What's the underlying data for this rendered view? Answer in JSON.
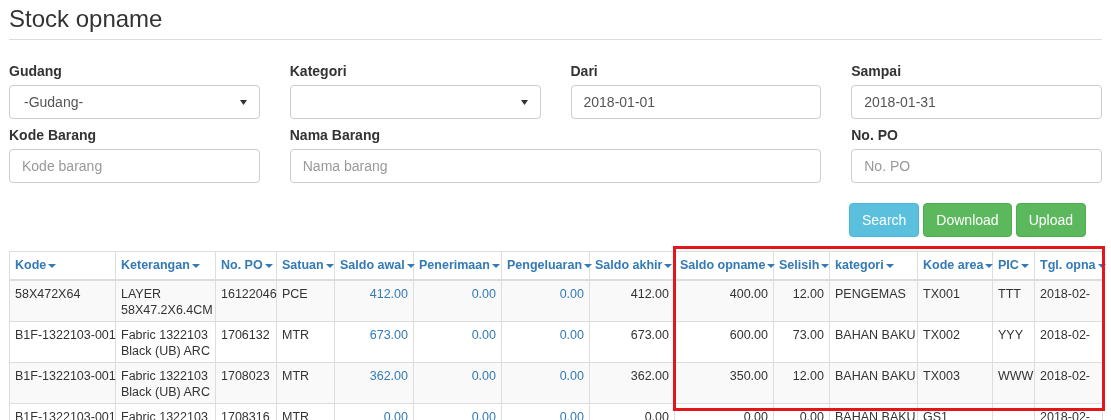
{
  "page": {
    "title": "Stock opname"
  },
  "filters": [
    {
      "label": "Gudang",
      "kind": "select",
      "value": "-Gudang-"
    },
    {
      "label": "Kategori",
      "kind": "select"
    },
    {
      "label": "Dari",
      "kind": "input",
      "value": "2018-01-01"
    },
    {
      "label": "Sampai",
      "kind": "input",
      "value": "2018-01-31"
    },
    {
      "label": "Kode Barang",
      "kind": "input",
      "placeholder": "Kode barang"
    },
    {
      "label": "Nama Barang",
      "kind": "input",
      "placeholder": "Nama barang"
    },
    {
      "label": "No. PO",
      "kind": "input",
      "placeholder": "No. PO"
    }
  ],
  "buttons": [
    {
      "label": "Search",
      "kind": "info"
    },
    {
      "label": "Download",
      "kind": "success"
    },
    {
      "label": "Upload",
      "kind": "success"
    }
  ],
  "table": {
    "columns": [
      {
        "label": "Kode",
        "kind": "text"
      },
      {
        "label": "Keterangan",
        "kind": "text"
      },
      {
        "label": "No. PO",
        "kind": "text"
      },
      {
        "label": "Satuan",
        "kind": "text"
      },
      {
        "label": "Saldo awal",
        "kind": "link"
      },
      {
        "label": "Penerimaan",
        "kind": "link"
      },
      {
        "label": "Pengeluaran",
        "kind": "link"
      },
      {
        "label": "Saldo akhir",
        "kind": "number"
      },
      {
        "label": "Saldo opname",
        "kind": "number"
      },
      {
        "label": "Selisih",
        "kind": "number"
      },
      {
        "label": "kategori",
        "kind": "text"
      },
      {
        "label": "Kode area",
        "kind": "text"
      },
      {
        "label": "PIC",
        "kind": "text"
      },
      {
        "label": "Tgl. opna",
        "kind": "text"
      }
    ],
    "rows": [
      [
        "58X472X64",
        "LAYER 58X47.2X6.4CM",
        "16122046",
        "PCE",
        "412.00",
        "0.00",
        "0.00",
        "412.00",
        "400.00",
        "12.00",
        "PENGEMAS",
        "TX001",
        "TTT",
        "2018-02-"
      ],
      [
        "B1F-1322103-001",
        "Fabric 1322103 Black (UB) ARC",
        "1706132",
        "MTR",
        "673.00",
        "0.00",
        "0.00",
        "673.00",
        "600.00",
        "73.00",
        "BAHAN BAKU",
        "TX002",
        "YYY",
        "2018-02-"
      ],
      [
        "B1F-1322103-001",
        "Fabric 1322103 Black (UB) ARC",
        "1708023",
        "MTR",
        "362.00",
        "0.00",
        "0.00",
        "362.00",
        "350.00",
        "12.00",
        "BAHAN BAKU",
        "TX003",
        "WWW",
        "2018-02-"
      ],
      [
        "B1F-1322103-001",
        "Fabric 1322103",
        "1708316",
        "MTR",
        "0.00",
        "0.00",
        "0.00",
        "0.00",
        "0.00",
        "0.00",
        "BAHAN BAKU",
        "GS1",
        "",
        "2018-02-"
      ]
    ]
  }
}
